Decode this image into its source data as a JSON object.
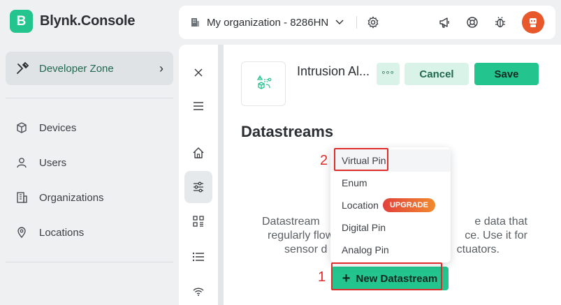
{
  "brand": {
    "logo_letter": "B",
    "name": "Blynk.Console",
    "color": "#23c48e"
  },
  "sidebar": {
    "developer_zone": "Developer Zone",
    "items": [
      {
        "label": "Devices",
        "icon": "cube-icon"
      },
      {
        "label": "Users",
        "icon": "user-icon"
      },
      {
        "label": "Organizations",
        "icon": "building-icon"
      },
      {
        "label": "Locations",
        "icon": "location-pin-icon"
      }
    ]
  },
  "header": {
    "organization": "My organization - 8286HN"
  },
  "template": {
    "name": "Intrusion Al...",
    "more_label": "°°°",
    "cancel_label": "Cancel",
    "save_label": "Save"
  },
  "datastreams": {
    "title": "Datastreams",
    "empty_line1": "Datastream",
    "empty_line1_end": "e data that",
    "empty_line2": "regularly flow",
    "empty_line2_end": "ce. Use it for",
    "empty_line3": "sensor d",
    "empty_line3_end": "ctuators.",
    "new_button": "New Datastream"
  },
  "dropdown": {
    "items": [
      "Virtual Pin",
      "Enum",
      "Location",
      "Digital Pin",
      "Analog Pin"
    ],
    "upgrade_badge": "UPGRADE"
  },
  "annotations": {
    "step1": "1",
    "step2": "2",
    "color": "#e02b2b"
  }
}
